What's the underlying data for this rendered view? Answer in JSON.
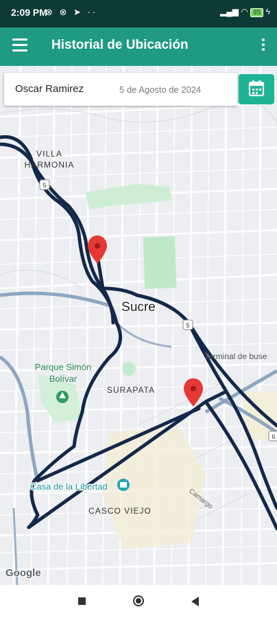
{
  "status_bar": {
    "time": "2:09 PM",
    "battery": "85"
  },
  "app_bar": {
    "title": "Historial de Ubicación"
  },
  "filter": {
    "user": "Oscar Ramirez",
    "date": "5 de Agosto de 2024"
  },
  "map": {
    "labels": {
      "villa": "VILLA",
      "harmonia": "HARMONIA",
      "city": "Sucre",
      "route": "5",
      "park_line1": "Parque Simón",
      "park_line2": "Bolívar",
      "surapata": "SURAPATA",
      "terminal": "Terminal de buse",
      "casa": "Casa de la Libertad",
      "casco": "CASCO VIEJO",
      "camargo": "Camargo",
      "six": "6"
    },
    "attribution": "Google"
  },
  "colors": {
    "primary": "#1f9b84",
    "status_bar": "#0e3a36",
    "route": "#13284a",
    "marker": "#e53935"
  }
}
